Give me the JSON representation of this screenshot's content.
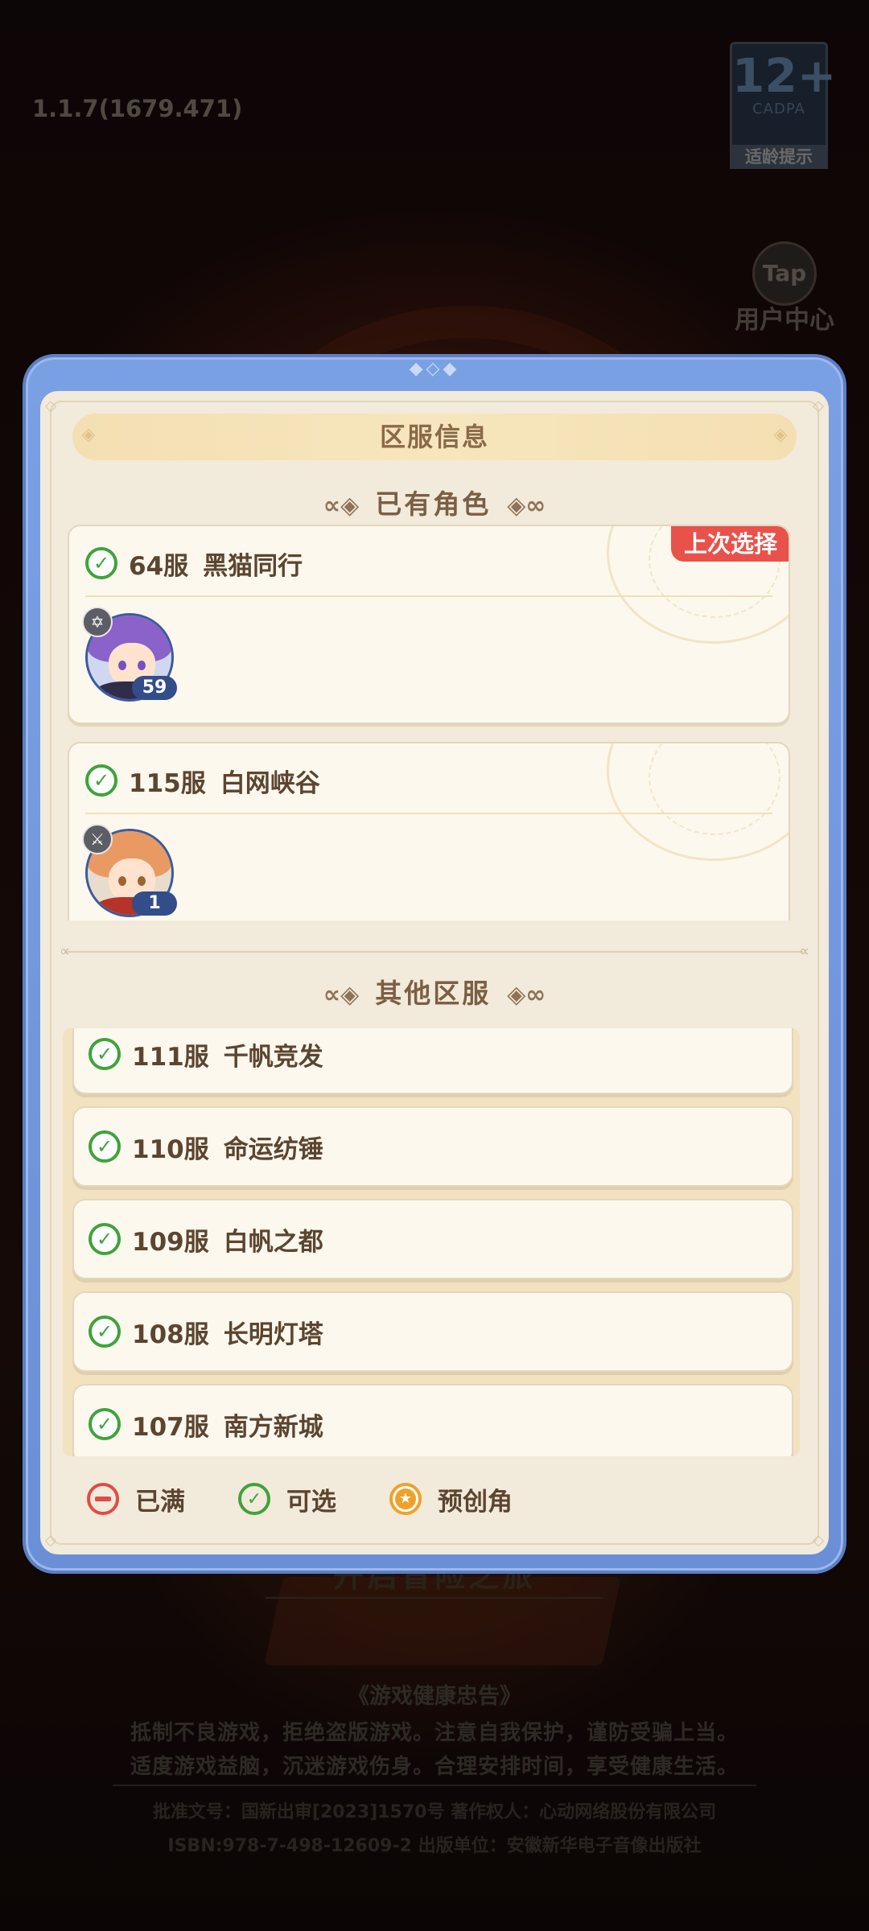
{
  "background": {
    "version": "1.1.7(1679.471)",
    "age_rating": {
      "number": "12+",
      "org": "CADPA",
      "tip": "适龄提示"
    },
    "tap": {
      "icon_text": "Tap",
      "label": "用户中心"
    },
    "start_button": "开启冒险之旅",
    "health": {
      "title": "《游戏健康忠告》",
      "line1": "抵制不良游戏，拒绝盗版游戏。注意自我保护，谨防受骗上当。",
      "line2": "适度游戏益脑，沉迷游戏伤身。合理安排时间，享受健康生活。"
    },
    "publish": {
      "line1": "批准文号：国新出审[2023]1570号  著作权人：心动网络股份有限公司",
      "line2": "ISBN:978-7-498-12609-2      出版单位：安徽新华电子音像出版社"
    }
  },
  "dialog": {
    "title": "区服信息",
    "existing_section": "已有角色",
    "other_section": "其他区服",
    "role_cards": [
      {
        "server": "64服",
        "name": "黑猫同行",
        "badge": "上次选择",
        "level": "59",
        "class_icon": "star-emblem-icon"
      },
      {
        "server": "115服",
        "name": "白网峡谷",
        "badge": "",
        "level": "1",
        "class_icon": "sword-icon"
      }
    ],
    "servers": [
      {
        "server": "111服",
        "name": "千帆竞发"
      },
      {
        "server": "110服",
        "name": "命运纺锤"
      },
      {
        "server": "109服",
        "name": "白帆之都"
      },
      {
        "server": "108服",
        "name": "长明灯塔"
      },
      {
        "server": "107服",
        "name": "南方新城"
      }
    ],
    "legend": {
      "full": "已满",
      "available": "可选",
      "precreate": "预创角"
    }
  },
  "colors": {
    "frame_blue": "#7aa0e4",
    "panel_cream": "#f2eadb",
    "check_green": "#3fa33a",
    "full_red": "#e14b45",
    "star_orange": "#f0a12a",
    "badge_red": "#e8524a",
    "text_brown": "#5c4530"
  }
}
